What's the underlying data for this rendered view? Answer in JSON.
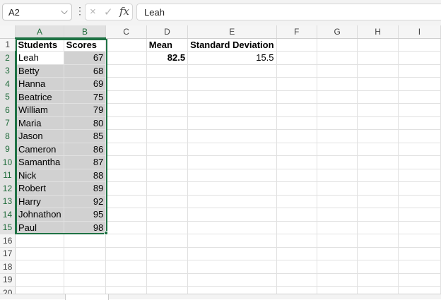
{
  "formula_bar": {
    "name_box": "A2",
    "formula": "Leah",
    "icons": {
      "cancel": "×",
      "enter": "✓",
      "function": "fx",
      "dropdown": "⌵",
      "more": "⋮"
    }
  },
  "columns": [
    "A",
    "B",
    "C",
    "D",
    "E",
    "F",
    "G",
    "H",
    "I"
  ],
  "rows": [
    {
      "n": "1",
      "A": "Students",
      "B": "Scores",
      "C": "",
      "D": "Mean",
      "E": "Standard Deviation"
    },
    {
      "n": "2",
      "A": "Leah",
      "B": "67",
      "C": "",
      "D": "82.5",
      "E": "15.5"
    },
    {
      "n": "3",
      "A": "Betty",
      "B": "68"
    },
    {
      "n": "4",
      "A": "Hanna",
      "B": "69"
    },
    {
      "n": "5",
      "A": "Beatrice",
      "B": "75"
    },
    {
      "n": "6",
      "A": "William",
      "B": "79"
    },
    {
      "n": "7",
      "A": "Maria",
      "B": "80"
    },
    {
      "n": "8",
      "A": "Jason",
      "B": "85"
    },
    {
      "n": "9",
      "A": "Cameron",
      "B": "86"
    },
    {
      "n": "10",
      "A": "Samantha",
      "B": "87"
    },
    {
      "n": "11",
      "A": "Nick",
      "B": "88"
    },
    {
      "n": "12",
      "A": "Robert",
      "B": "89"
    },
    {
      "n": "13",
      "A": "Harry",
      "B": "92"
    },
    {
      "n": "14",
      "A": "Johnathon",
      "B": "95"
    },
    {
      "n": "15",
      "A": "Paul",
      "B": "98"
    },
    {
      "n": "16"
    },
    {
      "n": "17"
    },
    {
      "n": "18"
    },
    {
      "n": "19"
    },
    {
      "n": "20"
    }
  ],
  "colors": {
    "selection": "#1f7244",
    "highlight": "#d1d1d1"
  }
}
